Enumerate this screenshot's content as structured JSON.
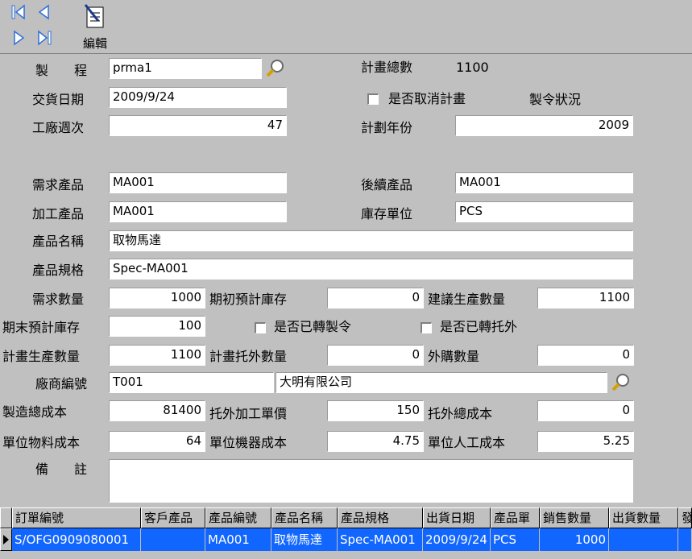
{
  "toolbar": {
    "edit_label": "編輯",
    "nav": [
      "first-icon",
      "prev-icon",
      "next-icon",
      "last-icon"
    ]
  },
  "form": {
    "process_label": "製　　程",
    "process_value": "prma1",
    "plan_total_label": "計畫總數",
    "plan_total_value": "1100",
    "delivery_date_label": "交貨日期",
    "delivery_date_value": "2009/9/24",
    "cancel_plan_label": "是否取消計畫",
    "order_status_label": "製令狀況",
    "factory_week_label": "工廠週次",
    "factory_week_value": "47",
    "plan_year_label": "計劃年份",
    "plan_year_value": "2009",
    "demand_product_label": "需求產品",
    "demand_product_value": "MA001",
    "next_product_label": "後續產品",
    "next_product_value": "MA001",
    "processed_product_label": "加工產品",
    "processed_product_value": "MA001",
    "stock_unit_label": "庫存單位",
    "stock_unit_value": "PCS",
    "product_name_label": "產品名稱",
    "product_name_value": "取物馬達",
    "product_spec_label": "產品規格",
    "product_spec_value": "Spec-MA001",
    "demand_qty_label": "需求數量",
    "demand_qty_value": "1000",
    "initial_est_stock_label": "期初預計庫存",
    "initial_est_stock_value": "0",
    "suggest_prod_qty_label": "建議生產數量",
    "suggest_prod_qty_value": "1100",
    "end_est_stock_label": "期末預計庫存",
    "end_est_stock_value": "100",
    "to_order_label": "是否已轉製令",
    "to_outsource_label": "是否已轉托外",
    "plan_prod_qty_label": "計畫生產數量",
    "plan_prod_qty_value": "1100",
    "plan_outsource_qty_label": "計畫托外數量",
    "plan_outsource_qty_value": "0",
    "purchase_qty_label": "外購數量",
    "purchase_qty_value": "0",
    "vendor_no_label": "廠商編號",
    "vendor_no_value": "T001",
    "vendor_name_value": "大明有限公司",
    "total_cost_label": "製造總成本",
    "total_cost_value": "81400",
    "outsource_unit_price_label": "托外加工單價",
    "outsource_unit_price_value": "150",
    "outsource_total_cost_label": "托外總成本",
    "outsource_total_cost_value": "0",
    "unit_material_cost_label": "單位物料成本",
    "unit_material_cost_value": "64",
    "unit_machine_cost_label": "單位機器成本",
    "unit_machine_cost_value": "4.75",
    "unit_labor_cost_label": "單位人工成本",
    "unit_labor_cost_value": "5.25",
    "remarks_label": "備　　註",
    "remarks_value": ""
  },
  "grid": {
    "headers": [
      "訂單編號",
      "客戶產品",
      "產品編號",
      "產品名稱",
      "產品規格",
      "出貨日期",
      "產品單",
      "銷售數量",
      "出貨數量",
      "發"
    ],
    "row": [
      "S/OFG0909080001",
      "",
      "MA001",
      "取物馬達",
      "Spec-MA001",
      "2009/9/24",
      "PCS",
      "1000",
      "",
      ""
    ]
  },
  "colors": {
    "background": "#c0c0c0",
    "selection": "#1166ff",
    "icon_blue": "#2f6fd6"
  }
}
